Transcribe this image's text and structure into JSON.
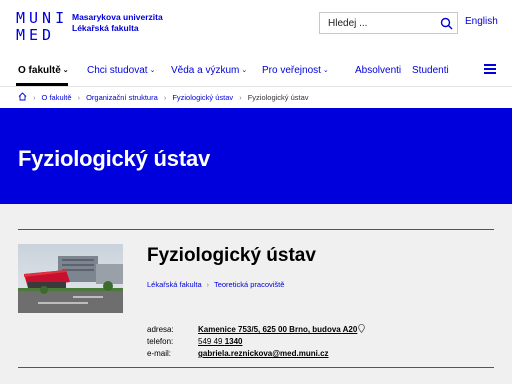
{
  "header": {
    "logo_line1": "MUNI",
    "logo_line2": "MED",
    "brand_line1": "Masarykova univerzita",
    "brand_line2": "Lékařská fakulta",
    "search_placeholder": "Hledej ...",
    "language": "English"
  },
  "nav": {
    "items": [
      {
        "label": "O fakultě",
        "active": true
      },
      {
        "label": "Chci studovat"
      },
      {
        "label": "Věda a výzkum"
      },
      {
        "label": "Pro veřejnost"
      },
      {
        "label": "Absolventi"
      },
      {
        "label": "Studenti"
      }
    ],
    "chevron_icon": "chevron-down-icon",
    "menu_icon": "hamburger-menu-icon"
  },
  "breadcrumb": {
    "home_icon": "home-icon",
    "items": [
      "O fakultě",
      "Organizační struktura",
      "Fyziologický ústav",
      "Fyziologický ústav"
    ]
  },
  "hero": {
    "title": "Fyziologický ústav"
  },
  "card": {
    "title": "Fyziologický ústav",
    "tags": [
      "Lékařská fakulta",
      "Teoretická pracoviště"
    ],
    "address_label": "adresa:",
    "address": "Kamenice 753/5, 625 00 Brno, budova A20",
    "phone_label": "telefon:",
    "phone_prefix": "549 49",
    "phone_suffix": "1340",
    "email_label": "e-mail:",
    "email": "gabriela.reznickova@med.muni.cz",
    "pin_icon": "map-pin-icon"
  },
  "colors": {
    "brand_blue": "#0000dc",
    "content_bg": "#f0f0f0"
  }
}
